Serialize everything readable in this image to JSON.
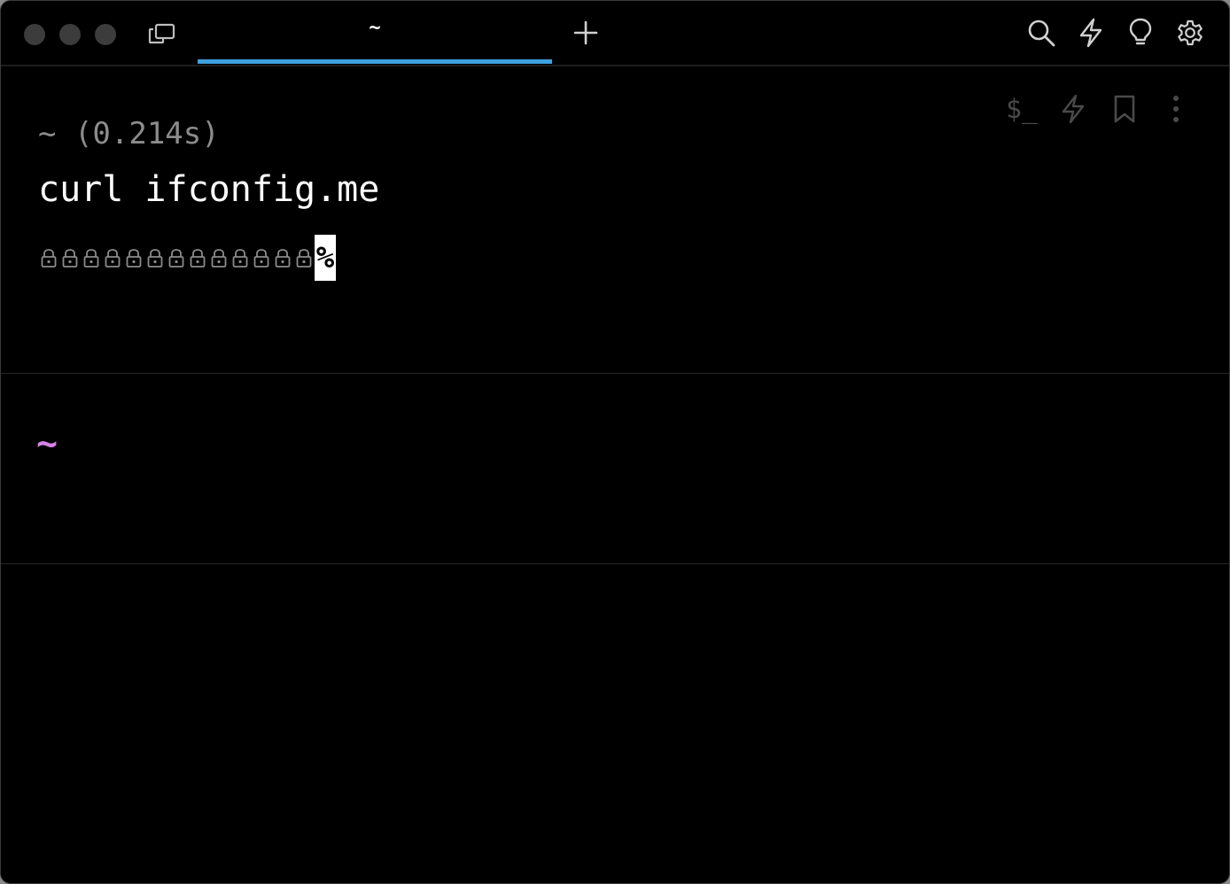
{
  "window": {
    "tab_title": "~",
    "accent_color": "#3fa0e0"
  },
  "titlebar_icons": [
    "tabs-icon",
    "plus-icon",
    "search-icon",
    "bolt-icon",
    "lightbulb-icon",
    "gear-icon"
  ],
  "block": {
    "prompt": "~ (0.214s)",
    "command": "curl ifconfig.me",
    "output_glyph_count": 13,
    "output_glyph": "lock-icon",
    "end_marker": "%",
    "actions": {
      "shell_label": "$_",
      "icons": [
        "bolt-icon",
        "bookmark-icon",
        "more-vertical-icon"
      ]
    }
  },
  "input": {
    "prompt": "~",
    "prompt_color": "#d683e8"
  }
}
